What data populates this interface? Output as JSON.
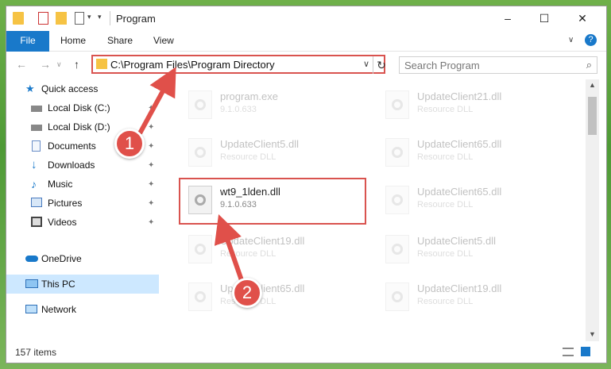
{
  "window": {
    "title": "Program"
  },
  "ribbon": {
    "tabs": [
      "File",
      "Home",
      "Share",
      "View"
    ]
  },
  "address": {
    "path": "C:\\Program Files\\Program Directory",
    "search_placeholder": "Search Program"
  },
  "sidebar": {
    "items": [
      {
        "label": "Quick access",
        "icon": "star-icon",
        "pinned": false
      },
      {
        "label": "Local Disk (C:)",
        "icon": "drive-icon",
        "pinned": true
      },
      {
        "label": "Local Disk (D:)",
        "icon": "drive-icon",
        "pinned": true
      },
      {
        "label": "Documents",
        "icon": "document-icon",
        "pinned": true
      },
      {
        "label": "Downloads",
        "icon": "download-icon",
        "pinned": true
      },
      {
        "label": "Music",
        "icon": "music-icon",
        "pinned": true
      },
      {
        "label": "Pictures",
        "icon": "pictures-icon",
        "pinned": true
      },
      {
        "label": "Videos",
        "icon": "videos-icon",
        "pinned": true
      },
      {
        "label": "OneDrive",
        "icon": "cloud-icon",
        "pinned": false
      },
      {
        "label": "This PC",
        "icon": "computer-icon",
        "pinned": false,
        "selected": true
      },
      {
        "label": "Network",
        "icon": "network-icon",
        "pinned": false
      }
    ]
  },
  "files": [
    {
      "name": "program.exe",
      "sub": "9.1.0.633"
    },
    {
      "name": "UpdateClient21.dll",
      "sub": "Resource DLL"
    },
    {
      "name": "UpdateClient5.dll",
      "sub": "Resource DLL"
    },
    {
      "name": "UpdateClient65.dll",
      "sub": "Resource DLL"
    },
    {
      "name": "wt9_1lden.dll",
      "sub": "9.1.0.633",
      "highlighted": true
    },
    {
      "name": "UpdateClient65.dll",
      "sub": "Resource DLL"
    },
    {
      "name": "UpdateClient19.dll",
      "sub": "Resource DLL"
    },
    {
      "name": "UpdateClient5.dll",
      "sub": "Resource DLL"
    },
    {
      "name": "UpdateClient65.dll",
      "sub": "Resource DLL"
    },
    {
      "name": "UpdateClient19.dll",
      "sub": "Resource DLL"
    }
  ],
  "status": {
    "item_count": "157 items"
  },
  "markers": [
    "1",
    "2"
  ],
  "colors": {
    "accent": "#1979ca",
    "highlight": "#d9534f",
    "marker": "#e0504a"
  }
}
